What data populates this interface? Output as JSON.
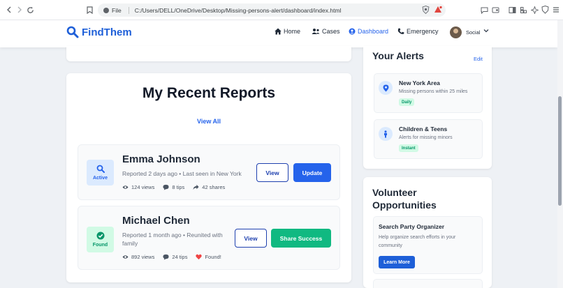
{
  "browser": {
    "protocol": "File",
    "url": "C:/Users/DELL/OneDrive/Desktop/Missing-persons-alert/dashboard/index.html"
  },
  "header": {
    "brand": "FindThem",
    "nav": [
      {
        "label": "Home",
        "icon": "home-icon"
      },
      {
        "label": "Cases",
        "icon": "users-icon"
      },
      {
        "label": "Dashboard",
        "icon": "user-circle-icon",
        "active": true
      },
      {
        "label": "Emergency",
        "icon": "phone-icon"
      }
    ],
    "user_label": "Social"
  },
  "reports": {
    "title": "My Recent Reports",
    "view_all": "View All",
    "items": [
      {
        "name": "Emma Johnson",
        "status": "Active",
        "meta": "Reported 2 days ago • Last seen in New York",
        "views": "124 views",
        "tips": "8 tips",
        "third": "42 shares",
        "buttons": [
          "View",
          "Update"
        ]
      },
      {
        "name": "Michael Chen",
        "status": "Found",
        "meta": "Reported 1 month ago • Reunited with family",
        "views": "892 views",
        "tips": "24 tips",
        "third": "Found!",
        "buttons": [
          "View",
          "Share Success"
        ]
      }
    ]
  },
  "alerts": {
    "title": "Your Alerts",
    "edit": "Edit",
    "items": [
      {
        "title": "New York Area",
        "desc": "Missing persons within 25 miles",
        "tag": "Daily",
        "icon": "map-pin-icon"
      },
      {
        "title": "Children & Teens",
        "desc": "Alerts for missing minors",
        "tag": "Instant",
        "icon": "child-icon"
      }
    ]
  },
  "volunteer": {
    "title": "Volunteer Opportunities",
    "item": {
      "name": "Search Party Organizer",
      "desc": "Help organize search efforts in your community",
      "button": "Learn More"
    }
  },
  "colors": {
    "primary": "#2563eb",
    "success": "#10b981",
    "background": "#eef1f5"
  }
}
